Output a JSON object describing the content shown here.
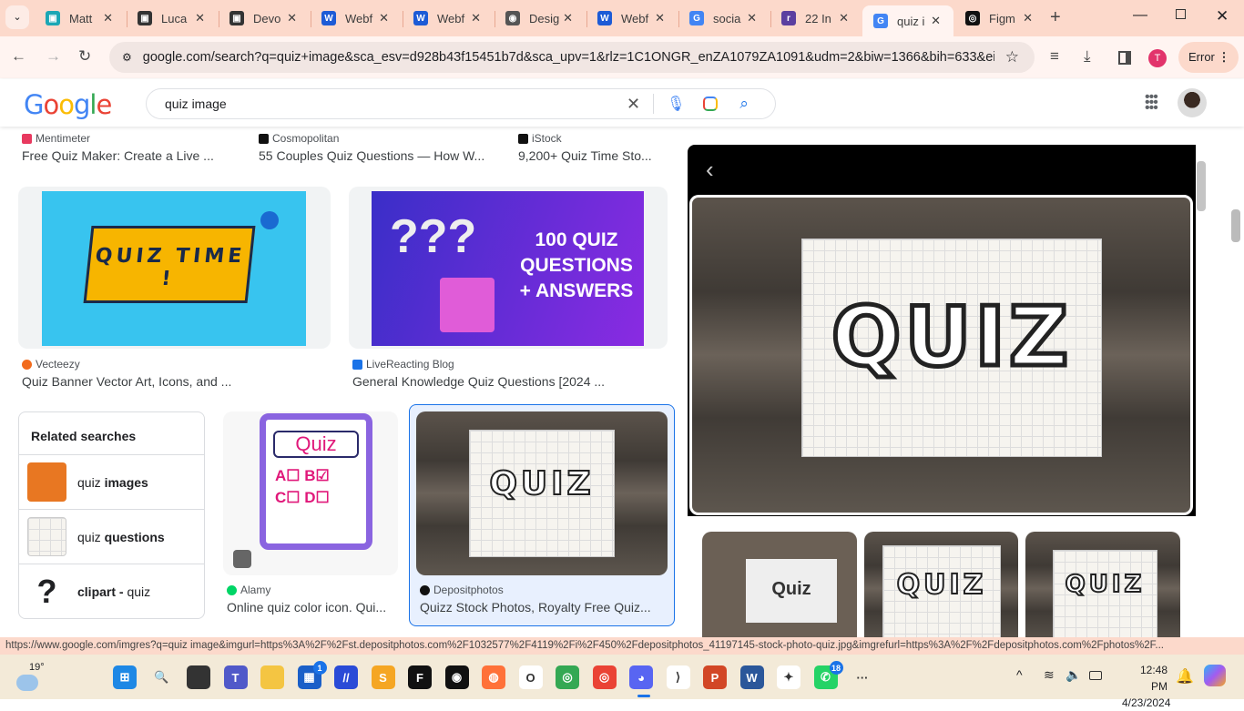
{
  "browser": {
    "tabs": [
      {
        "title": "Matt",
        "color": "#1ba7b5",
        "glyph": "▣"
      },
      {
        "title": "Luca",
        "color": "#333",
        "glyph": "▣"
      },
      {
        "title": "Devo",
        "color": "#333",
        "glyph": "▣"
      },
      {
        "title": "Webf",
        "color": "#1d5bd6",
        "glyph": "W"
      },
      {
        "title": "Webf",
        "color": "#1d5bd6",
        "glyph": "W"
      },
      {
        "title": "Desig",
        "color": "#555",
        "glyph": "◉"
      },
      {
        "title": "Webf",
        "color": "#1d5bd6",
        "glyph": "W"
      },
      {
        "title": "socia",
        "color": "#4285f4",
        "glyph": "G"
      },
      {
        "title": "22 In",
        "color": "#5b3fa0",
        "glyph": "r"
      },
      {
        "title": "quiz i",
        "color": "#4285f4",
        "glyph": "G",
        "active": true
      },
      {
        "title": "Figm",
        "color": "#111",
        "glyph": "◎"
      }
    ],
    "url": "google.com/search?q=quiz+image&sca_esv=d928b43f15451b7d&sca_upv=1&rlz=1C1ONGR_enZA1079ZA1091&udm=2&biw=1366&bih=633&ei=F...",
    "profile_initial": "T",
    "error_label": "Error",
    "status_url": "https://www.google.com/imgres?q=quiz image&imgurl=https%3A%2F%2Fst.depositphotos.com%2F1032577%2F4119%2Fi%2F450%2Fdepositphotos_41197145-stock-photo-quiz.jpg&imgrefurl=https%3A%2F%2Fdepositphotos.com%2Fphotos%2F..."
  },
  "google": {
    "logo": "Google",
    "query": "quiz image"
  },
  "results": {
    "top_row": [
      {
        "source": "Mentimeter",
        "title": "Free Quiz Maker: Create a Live ...",
        "color": "#e8395f"
      },
      {
        "source": "Cosmopolitan",
        "title": "55 Couples Quiz Questions — How W...",
        "color": "#111"
      },
      {
        "source": "iStock",
        "title": "9,200+ Quiz Time Sto...",
        "color": "#111"
      }
    ],
    "row2": [
      {
        "source": "Vecteezy",
        "title": "Quiz Banner Vector Art, Icons, and ...",
        "color": "#f26b1d",
        "image_text": "QUIZ TIME !"
      },
      {
        "source": "LiveReacting Blog",
        "title": "General Knowledge Quiz Questions [2024 ...",
        "color": "#1a73e8",
        "image_text": "100 QUIZ QUESTIONS + ANSWERS"
      }
    ],
    "row3": [
      {
        "source": "Alamy",
        "title": "Online quiz color icon. Qui...",
        "color": "#00d566",
        "image_text": "Quiz"
      },
      {
        "source": "Depositphotos",
        "title": "Quizz Stock Photos, Royalty Free Quiz...",
        "color": "#111",
        "image_text": "QUIZ"
      }
    ]
  },
  "related": {
    "heading": "Related searches",
    "items": [
      {
        "plain": "quiz ",
        "bold": "images",
        "order": "pb"
      },
      {
        "plain": "quiz ",
        "bold": "questions",
        "order": "pb"
      },
      {
        "bold": "clipart - ",
        "plain": "quiz",
        "order": "bp"
      }
    ]
  },
  "preview": {
    "main_text": "QUIZ",
    "thumbs": [
      "Quiz",
      "QUIZ",
      "QUIZ"
    ]
  },
  "taskbar": {
    "weather": "19°",
    "time": "12:48 PM",
    "date": "4/23/2024",
    "store_badge": "1",
    "whatsapp_badge": "18"
  }
}
